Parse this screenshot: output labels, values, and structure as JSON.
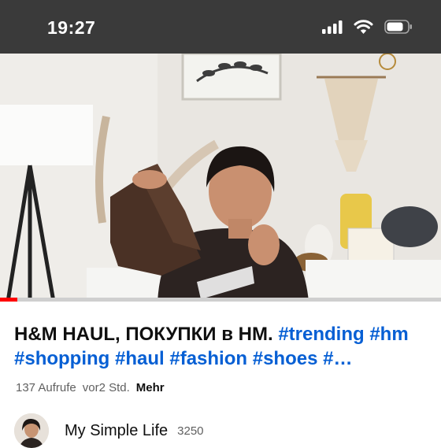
{
  "status_bar": {
    "time": "19:27",
    "icons": [
      "cellular-signal-icon",
      "wifi-icon",
      "battery-icon"
    ]
  },
  "video": {
    "thumbnail": "woman-holding-brown-boots",
    "progress_fraction": 0.04
  },
  "title": {
    "text": "H&M HAUL, ПОКУПКИ в HM. ",
    "hashtags": [
      "#trending",
      "#hm",
      "#shopping",
      "#haul",
      "#fashion",
      "#shoes",
      "#…"
    ]
  },
  "meta": {
    "views": "137 Aufrufe",
    "time_ago": "vor2 Std.",
    "more": "Mehr"
  },
  "channel": {
    "name": "My Simple Life",
    "subscribers": "3250"
  },
  "colors": {
    "status_bar": "#3a3a3a",
    "progress": "#ff0000",
    "hashtag": "#065fd4"
  }
}
